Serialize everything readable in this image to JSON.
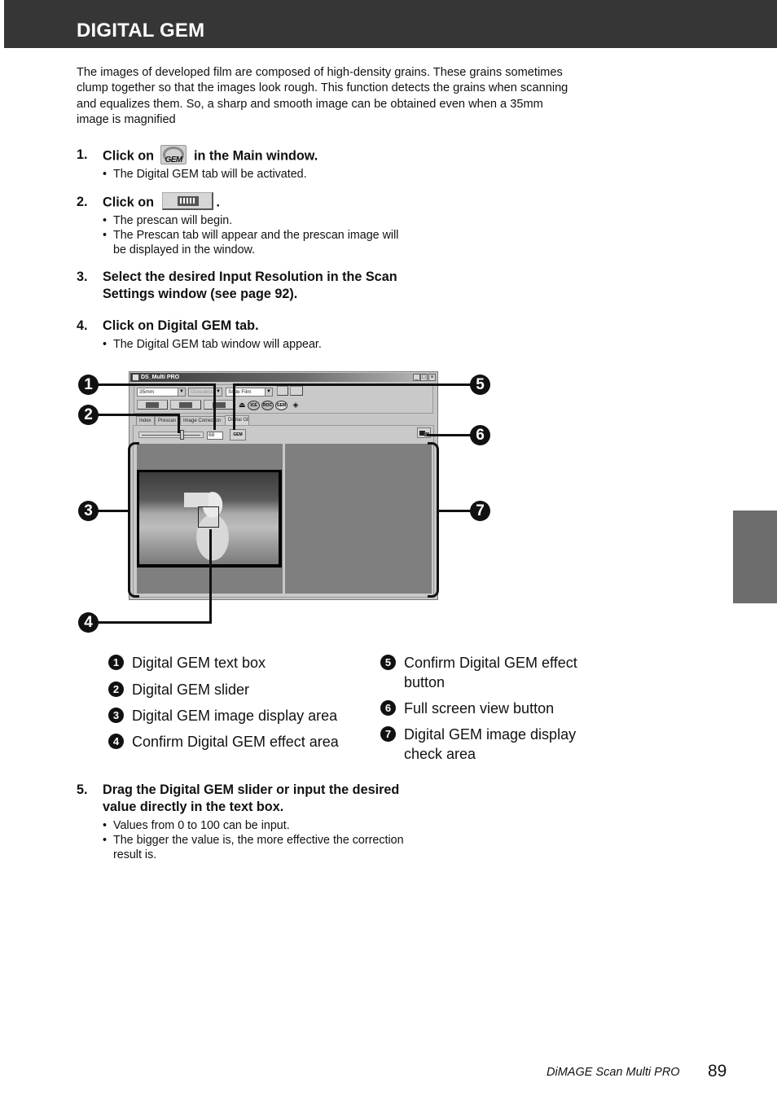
{
  "header": {
    "title": "DIGITAL GEM"
  },
  "intro": {
    "lines": [
      "The images of developed film are composed of high-density grains. These grains sometimes",
      "clump together so that the images look rough. This function detects the grains when scanning",
      "and equalizes them. So, a sharp and smooth image can be obtained even when a 35mm",
      "image is magnified"
    ]
  },
  "steps": [
    {
      "num": "1.",
      "text_before": "Click on",
      "icon": "digital-gem-button-icon",
      "icon_label": "GEM",
      "text_after": "in the Main window.",
      "bullets": [
        "The Digital GEM tab will be activated."
      ]
    },
    {
      "num": "2.",
      "text_before": "Click on",
      "icon": "prescan-button-icon",
      "text_after": ".",
      "bullets": [
        "The prescan will begin.",
        "The Prescan tab will appear and the prescan image will",
        "be displayed in the window."
      ]
    },
    {
      "num": "3.",
      "lines": [
        "Select the desired Input Resolution in the Scan",
        "Settings window (see page 92)."
      ]
    },
    {
      "num": "4.",
      "lines": [
        "Click on Digital GEM tab."
      ],
      "bullets": [
        "The Digital GEM tab window will appear."
      ]
    },
    {
      "num": "5.",
      "lines": [
        "Drag the Digital GEM slider or input the desired",
        "value directly in the text box."
      ],
      "bullets": [
        "Values from 0 to 100 can be input.",
        "The bigger the value is, the more effective the correction",
        "result is."
      ]
    }
  ],
  "window": {
    "title": "DS_Multi PRO",
    "controls": {
      "minimize": "_",
      "maximize": "□",
      "close": "×"
    },
    "film_format": "35mm",
    "holder": "Glassless",
    "film_type": "Slide Film",
    "correction_buttons": [
      "ICE",
      "ROC",
      "GEM"
    ],
    "tabs": [
      "Index",
      "Prescan",
      "Image Correction",
      "Digital GEM"
    ],
    "active_tab": "Digital GEM",
    "gem_value": "68",
    "gem_slider_value": 68,
    "gem_slider_range": [
      0,
      100
    ],
    "gem_confirm_label": "GEM"
  },
  "callouts": [
    "1",
    "2",
    "3",
    "4",
    "5",
    "6",
    "7"
  ],
  "legend": [
    {
      "n": "1",
      "lines": [
        "Digital GEM text box"
      ]
    },
    {
      "n": "2",
      "lines": [
        "Digital GEM slider"
      ]
    },
    {
      "n": "3",
      "lines": [
        "Digital GEM image display area"
      ]
    },
    {
      "n": "4",
      "lines": [
        "Confirm Digital GEM effect area"
      ]
    },
    {
      "n": "5",
      "lines": [
        "Confirm Digital GEM effect",
        "button"
      ]
    },
    {
      "n": "6",
      "lines": [
        "Full screen view button"
      ]
    },
    {
      "n": "7",
      "lines": [
        "Digital GEM image display",
        "check area"
      ]
    }
  ],
  "footer": {
    "product": "DiMAGE Scan Multi PRO",
    "page": "89"
  },
  "colors": {
    "header_bg": "#363636",
    "side_tab": "#6d6d6d",
    "display_bg": "#7f7f7f"
  }
}
